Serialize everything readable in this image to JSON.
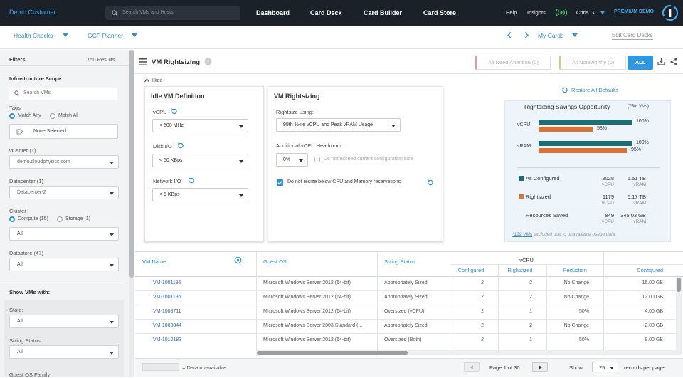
{
  "topbar": {
    "customer": "Demo Customer",
    "search_placeholder": "Search VMs and Hosts",
    "nav": [
      "Dashboard",
      "Card Deck",
      "Card Builder",
      "Card Store"
    ],
    "help": "Help",
    "insights": "Insights",
    "user": "Chris G.",
    "premium": "PREMIUM DEMO"
  },
  "subbar": {
    "health_checks": "Health Checks",
    "gcp_planner": "GCP Planner",
    "my_cards": "My Cards",
    "edit_card_decks": "Edit Card Decks"
  },
  "sidebar": {
    "filters": "Filters",
    "results": "750 Results",
    "infra_scope": "Infrastructure Scope",
    "search_placeholder": "Search VMs",
    "tags": "Tags",
    "match_any": "Match Any",
    "match_all": "Match All",
    "none_selected": "None Selected",
    "vcenter": "vCenter (1)",
    "vcenter_value": "demo.cloudphysics.com",
    "datacenter": "Datacenter (1)",
    "datacenter_value": "Datacenter-2",
    "cluster": "Cluster",
    "compute": "Compute (15)",
    "storage": "Storage (1)",
    "cluster_value": "All",
    "datastore": "Datastore (47)",
    "datastore_value": "All",
    "show_vms": "Show VMs with:",
    "state": "State:",
    "state_value": "All",
    "sizing_status": "Sizing Status",
    "sizing_value": "All",
    "guest_os": "Guest OS Family"
  },
  "main": {
    "title": "VM Rightsizing",
    "all_need_attention": "All Need Attention (0)",
    "all_noteworthy": "All Noteworthy (0)",
    "all": "ALL",
    "hide": "Hide",
    "restore_defaults": "Restore All Defaults"
  },
  "idle": {
    "title": "Idle VM Definition",
    "vcpu_label": "vCPU",
    "vcpu_value": "< 500 MHz",
    "disk_label": "Disk I/O",
    "disk_value": "< 50 KBps",
    "net_label": "Network I/O",
    "net_value": "< 5 KBps"
  },
  "rightsizing": {
    "title": "VM Rightsizing",
    "using_label": "Rightsize using:",
    "using_value": "99th %-ile vCPU and Peak vRAM Usage",
    "headroom_label": "Additional vCPU Headroom:",
    "headroom_value": "0%",
    "no_exceed": "Do not exceed current configuration size",
    "no_resize": "Do not resize below CPU and Memory reservations"
  },
  "savings": {
    "title": "Rightsizing Savings Opportunity",
    "title_suffix": "(750* VMs)",
    "vcpu_label": "vCPU",
    "vcpu_configured_pct": "100%",
    "vcpu_rightsized_pct": "58%",
    "vram_label": "vRAM",
    "vram_configured_pct": "100%",
    "vram_rightsized_pct": "95%",
    "vcpu_configured_frac": 1.0,
    "vcpu_rightsized_frac": 0.58,
    "vram_configured_frac": 1.0,
    "vram_rightsized_frac": 0.95,
    "as_configured": "As Configured",
    "as_cfg_vcpu": "2028",
    "as_cfg_vram": "6.51 TB",
    "rightsized": "Rightsized",
    "rs_vcpu": "1179",
    "rs_vram": "6.17 TB",
    "resources_saved": "Resources Saved",
    "saved_vcpu": "849",
    "saved_vram": "345.03 GB",
    "unit_vcpu": "vCPU",
    "unit_vram": "vRAM",
    "footnote_link": "*129 VMs",
    "footnote": " excluded due to unavailable usage data.",
    "colors": {
      "configured": "#1b6e74",
      "rightsized": "#d9733a"
    }
  },
  "table": {
    "col_vm": "VM Name",
    "col_os": "Guest OS",
    "col_status": "Sizing Status",
    "group_vcpu": "vCPU",
    "col_configured": "Configured",
    "col_rightsized": "Rightsized",
    "col_reduction": "Reduction",
    "col_configured2": "Configured",
    "rows": [
      {
        "vm": "VM-1001195",
        "os": "Microsoft Windows Server 2012 (64-bit)",
        "status": "Appropriately Sized",
        "cfg": "2",
        "rs": "2",
        "red": "No Change",
        "mem": "16.00 GB"
      },
      {
        "vm": "VM-1001196",
        "os": "Microsoft Windows Server 2012 (64-bit)",
        "status": "Appropriately Sized",
        "cfg": "2",
        "rs": "2",
        "red": "No Change",
        "mem": "12.00 GB"
      },
      {
        "vm": "VM-1008711",
        "os": "Microsoft Windows Server 2012 (64-bit)",
        "status": "Oversized (vCPU)",
        "cfg": "2",
        "rs": "1",
        "red": "50%",
        "mem": "4.00 GB"
      },
      {
        "vm": "VM-1008844",
        "os": "Microsoft Windows Server 2003 Standard (...",
        "status": "Appropriately Sized",
        "cfg": "2",
        "rs": "2",
        "red": "No Change",
        "mem": "2.00 GB"
      },
      {
        "vm": "VM-1010183",
        "os": "Microsoft Windows Server 2012 (64-bit)",
        "status": "Oversized (Both)",
        "cfg": "2",
        "rs": "1",
        "red": "50%",
        "mem": "8.00 GB"
      }
    ]
  },
  "footer": {
    "data_unavailable": "= Data unavailable",
    "page": "Page 1 of 30",
    "show": "Show",
    "per_page": "25",
    "records_per_page": "records per page"
  }
}
